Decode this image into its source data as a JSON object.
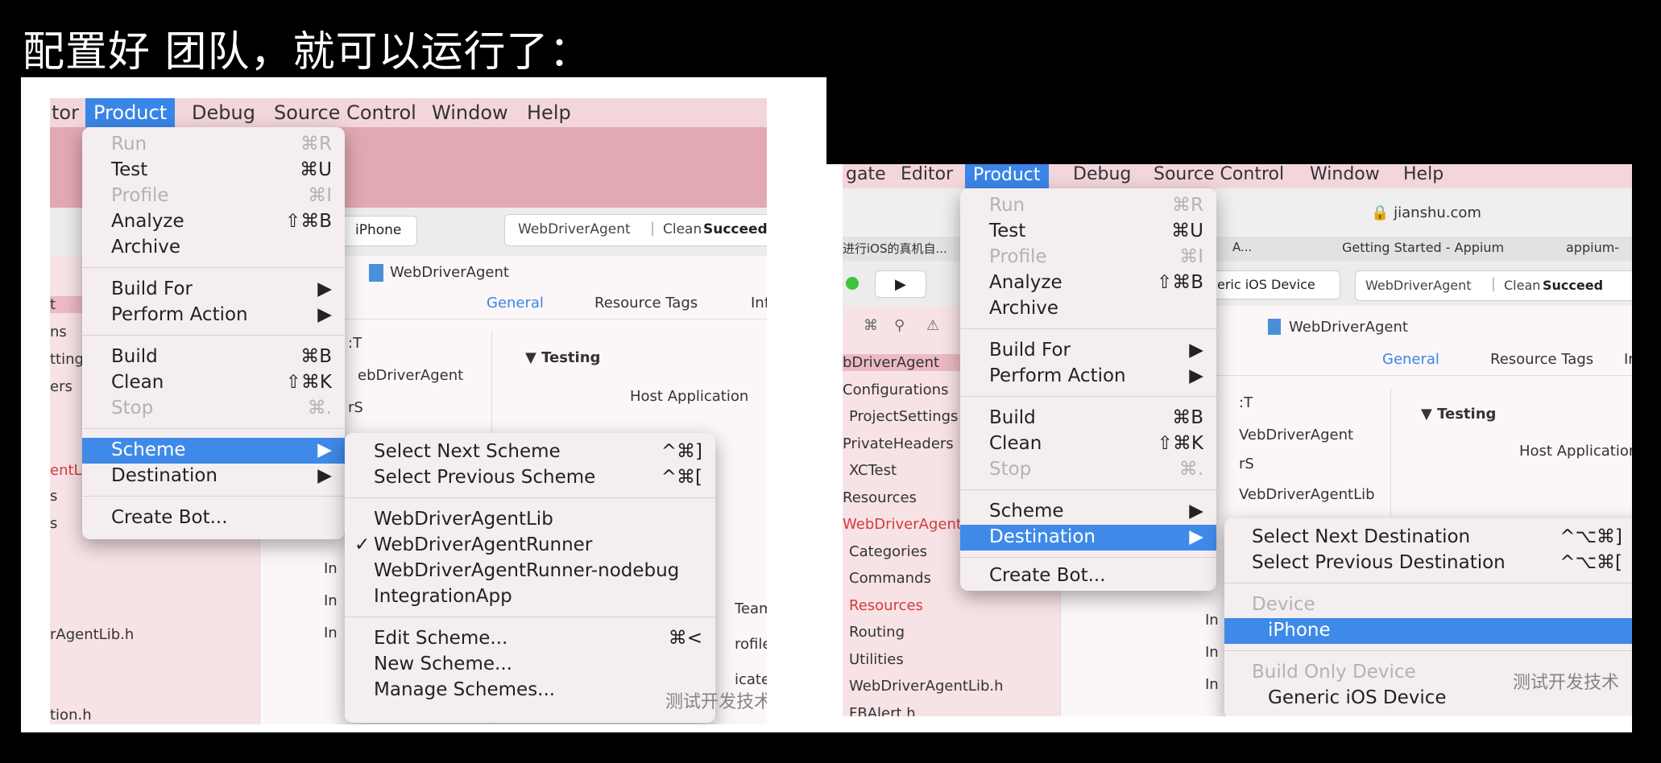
{
  "caption": "配置好 团队，就可以运行了：",
  "left": {
    "menubar": {
      "editor_partial": "tor",
      "product": "Product",
      "debug": "Debug",
      "source_control": "Source Control",
      "window": "Window",
      "help": "Help"
    },
    "toolbar": {
      "device": "iPhone",
      "status_target": "WebDriverAgent",
      "status_text": "Clean",
      "status_result": "Succeede"
    },
    "breadcrumb": "WebDriverAgent",
    "tabs": {
      "general": "General",
      "resource_tags": "Resource Tags",
      "info_partial": "Inf"
    },
    "editor": {
      "section_testing": "Testing",
      "host_application": "Host Application",
      "target_partial": "ebDriverAgent",
      "ct_partial": ":T",
      "rs_partial": "rS",
      "team_partial": "Team",
      "profile_partial": "rofile",
      "cate_partial": "icate",
      "i_partial": "In"
    },
    "sidebar": {
      "t": "t",
      "ns": "ns",
      "settings": "ttings",
      "ers": "ers",
      "entl": "entL",
      "s1": "s",
      "s2": "s",
      "agentlib": "rAgentLib.h",
      "tionh": "tion.h"
    },
    "product_menu": {
      "run": "Run",
      "run_sc": "⌘R",
      "test": "Test",
      "test_sc": "⌘U",
      "profile": "Profile",
      "profile_sc": "⌘I",
      "analyze": "Analyze",
      "analyze_sc": "⇧⌘B",
      "archive": "Archive",
      "build_for": "Build For",
      "perform_action": "Perform Action",
      "build": "Build",
      "build_sc": "⌘B",
      "clean": "Clean",
      "clean_sc": "⇧⌘K",
      "stop": "Stop",
      "stop_sc": "⌘.",
      "scheme": "Scheme",
      "destination": "Destination",
      "create_bot": "Create Bot...",
      "arrow": "▶"
    },
    "scheme_menu": {
      "next": "Select Next Scheme",
      "next_sc": "^⌘]",
      "prev": "Select Previous Scheme",
      "prev_sc": "^⌘[",
      "lib": "WebDriverAgentLib",
      "runner": "WebDriverAgentRunner",
      "nodebug": "WebDriverAgentRunner-nodebug",
      "integration": "IntegrationApp",
      "edit": "Edit Scheme...",
      "edit_sc": "⌘<",
      "new": "New Scheme...",
      "manage": "Manage Schemes...",
      "check": "✓"
    },
    "watermark": "测试开发技术"
  },
  "right": {
    "menubar": {
      "navigate_partial": "gate",
      "editor": "Editor",
      "product": "Product",
      "debug": "Debug",
      "source_control": "Source Control",
      "window": "Window",
      "help": "Help"
    },
    "address": "jianshu.com",
    "tabs_browser": {
      "t1": "进行iOS的真机自...",
      "t2": "A...",
      "t3": "Getting Started - Appium",
      "t4": "appium-"
    },
    "toolbar": {
      "device": "eneric iOS Device",
      "status_target": "WebDriverAgent",
      "status_text": "Clean",
      "status_result": "Succeed"
    },
    "breadcrumb": "WebDriverAgent",
    "tabs": {
      "general": "General",
      "resource_tags": "Resource Tags",
      "info_partial": "In"
    },
    "editor": {
      "section_testing": "Testing",
      "host_application": "Host Application",
      "ct_partial": ":T",
      "target_partial": "VebDriverAgent",
      "rs_partial": "rS",
      "lib_partial": "VebDriverAgentLib",
      "i_partial": "In"
    },
    "sidebar": [
      "bDriverAgent",
      "Configurations",
      "ProjectSettings",
      "PrivateHeaders",
      "XCTest",
      "Resources",
      "WebDriverAgentL",
      "Categories",
      "Commands",
      "Resources",
      "Routing",
      "Utilities",
      "WebDriverAgentLib.h",
      "FBAlert.h"
    ],
    "product_menu": {
      "run": "Run",
      "run_sc": "⌘R",
      "test": "Test",
      "test_sc": "⌘U",
      "profile": "Profile",
      "profile_sc": "⌘I",
      "analyze": "Analyze",
      "analyze_sc": "⇧⌘B",
      "archive": "Archive",
      "build_for": "Build For",
      "perform_action": "Perform Action",
      "build": "Build",
      "build_sc": "⌘B",
      "clean": "Clean",
      "clean_sc": "⇧⌘K",
      "stop": "Stop",
      "stop_sc": "⌘.",
      "scheme": "Scheme",
      "destination": "Destination",
      "create_bot": "Create Bot...",
      "arrow": "▶"
    },
    "destination_menu": {
      "next": "Select Next Destination",
      "next_sc": "^⌥⌘]",
      "prev": "Select Previous Destination",
      "prev_sc": "^⌥⌘[",
      "device_header": "Device",
      "iphone": "iPhone",
      "build_only_header": "Build Only Device",
      "generic": "Generic iOS Device"
    },
    "watermark": "测试开发技术"
  }
}
